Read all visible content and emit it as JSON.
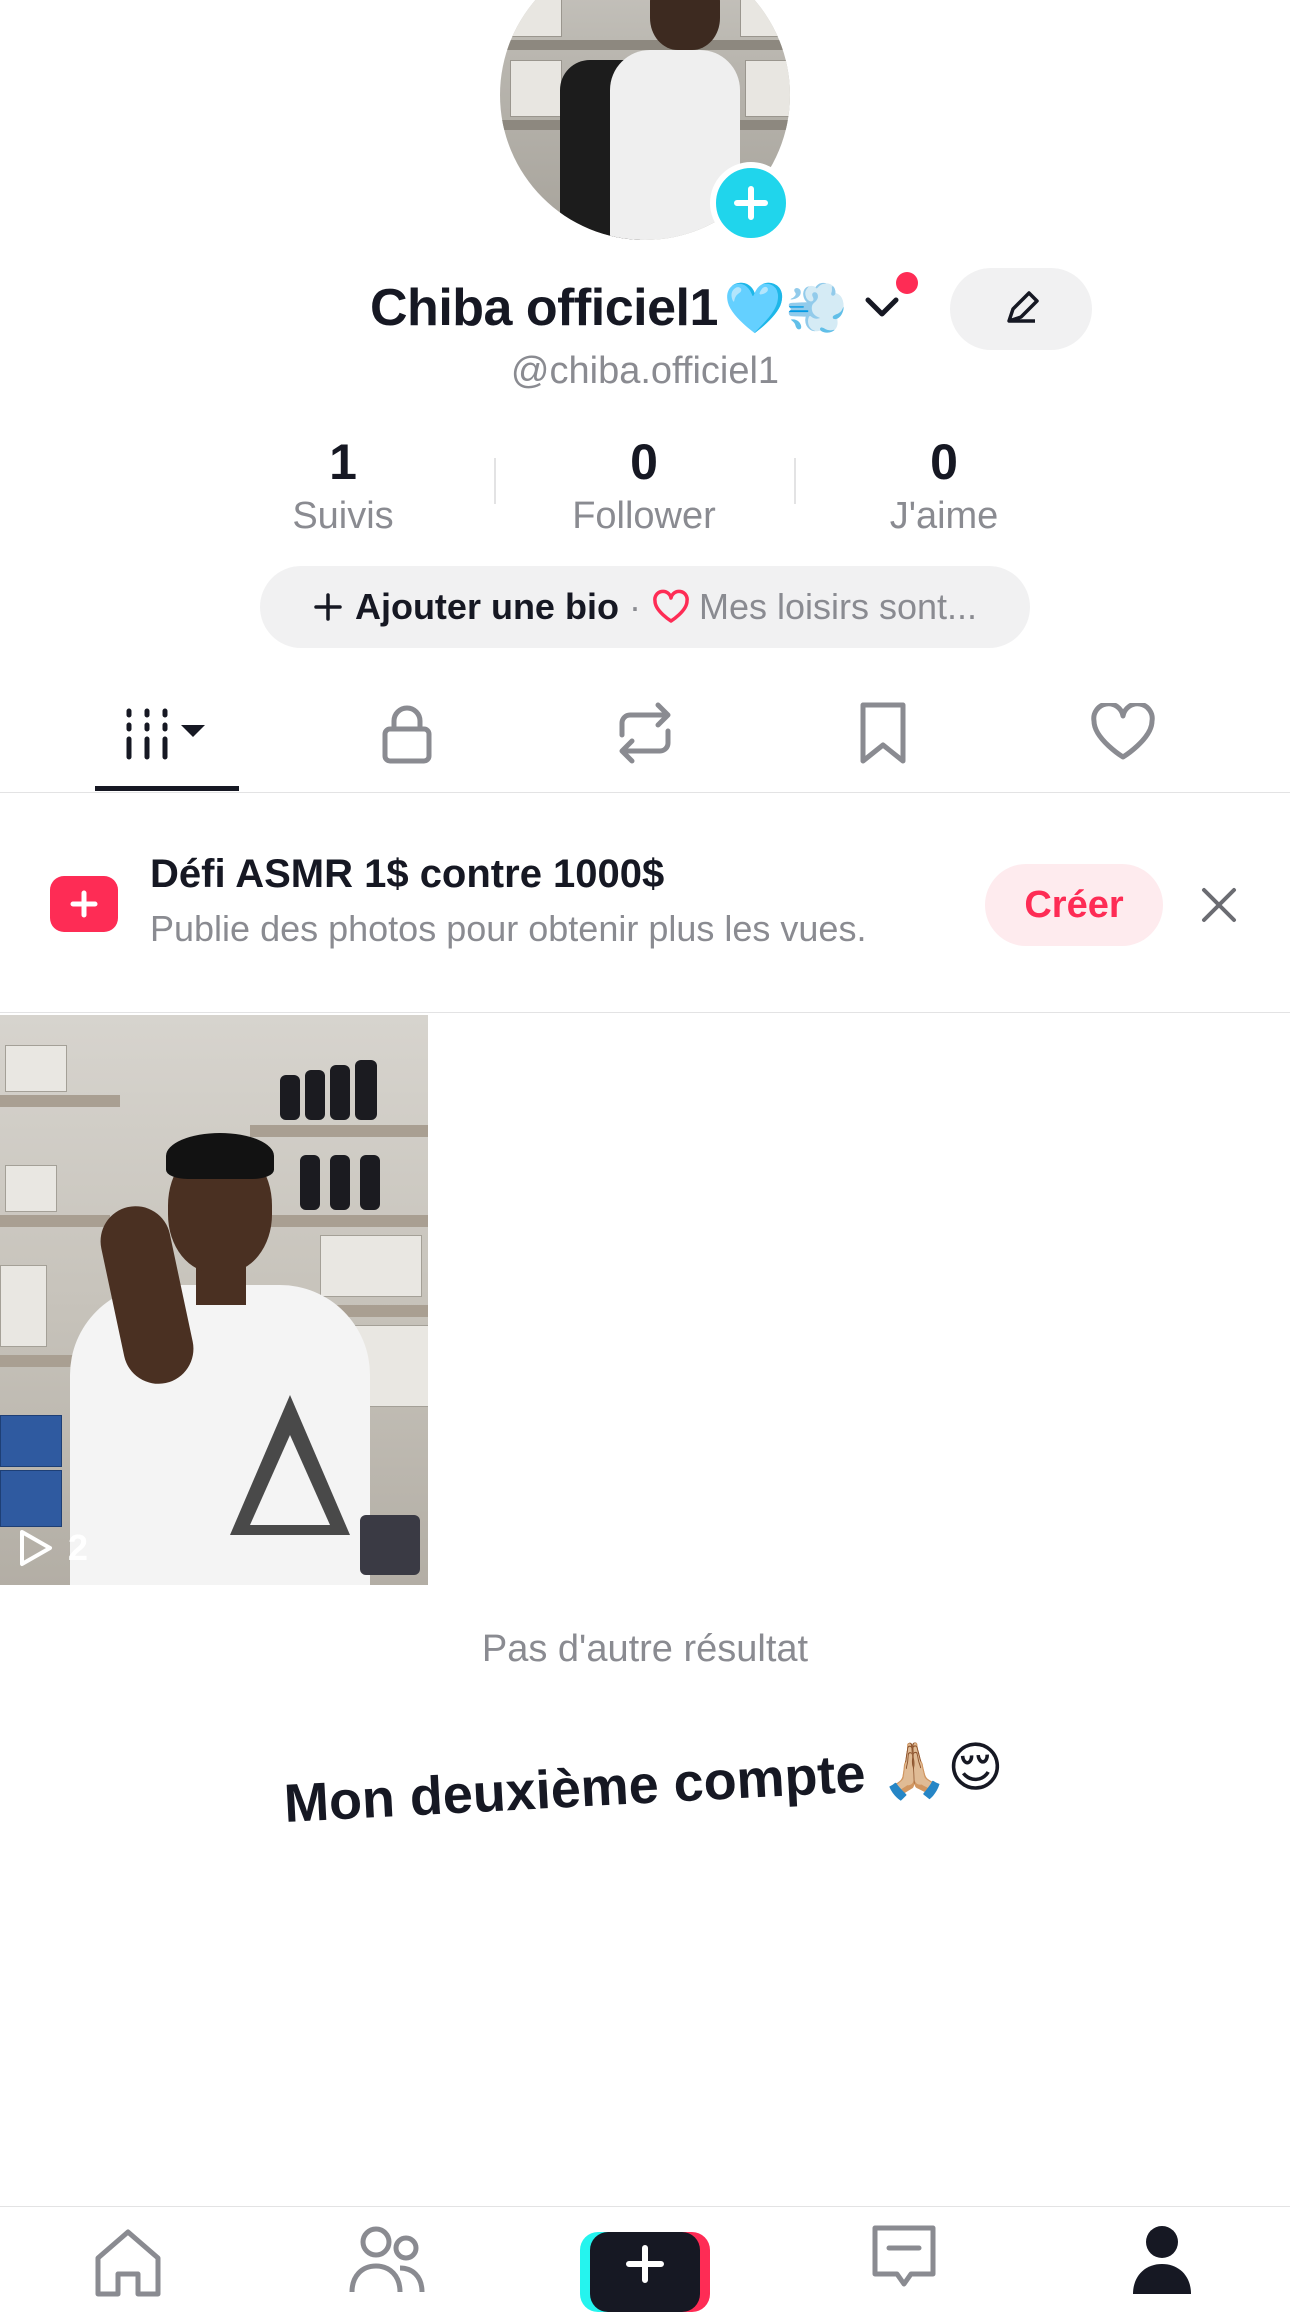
{
  "profile": {
    "name": "Chiba officiel1",
    "name_emojis": "🩵💨",
    "handle": "@chiba.officiel1"
  },
  "stats": [
    {
      "value": "1",
      "label": "Suivis"
    },
    {
      "value": "0",
      "label": "Follower"
    },
    {
      "value": "0",
      "label": "J'aime"
    }
  ],
  "bio": {
    "add_label": "Ajouter une bio",
    "separator": "·",
    "hobbies_label": "Mes loisirs sont..."
  },
  "tabs": [
    {
      "icon": "grid-icon",
      "active": true
    },
    {
      "icon": "lock-icon",
      "active": false
    },
    {
      "icon": "repost-icon",
      "active": false
    },
    {
      "icon": "bookmark-icon",
      "active": false
    },
    {
      "icon": "heart-icon",
      "active": false
    }
  ],
  "promo": {
    "title": "Défi ASMR 1$ contre 1000$",
    "subtitle": "Publie des photos pour obtenir plus les vues.",
    "button_label": "Créer"
  },
  "videos": [
    {
      "views": "2"
    }
  ],
  "no_more_results": "Pas d'autre résultat",
  "caption": {
    "text": "Mon deuxième compte",
    "emojis": "🙏🏼😌"
  },
  "bottom_nav": [
    "home-icon",
    "friends-icon",
    "create-icon",
    "inbox-icon",
    "profile-icon"
  ],
  "colors": {
    "accent": "#fe2c55",
    "cyan": "#20d5ec",
    "text_primary": "#161823",
    "text_secondary": "#8a8b91",
    "pill_bg": "#f1f1f2"
  }
}
